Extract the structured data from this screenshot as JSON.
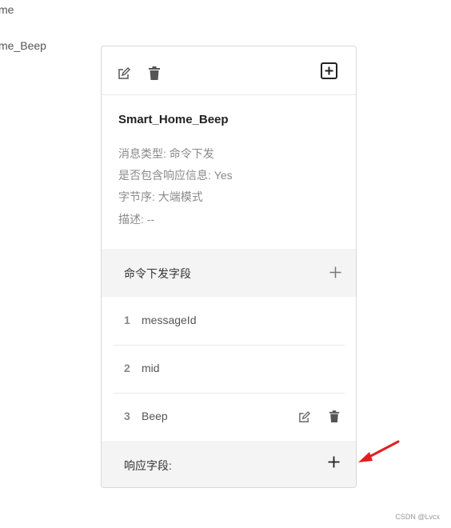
{
  "background": {
    "line1": "me",
    "line2": "me_Beep"
  },
  "card": {
    "toolbar": {
      "edit_icon": "edit-icon",
      "delete_icon": "trash-icon",
      "add_icon": "plus-square-icon"
    },
    "message_name": "Smart_Home_Beep",
    "meta": {
      "type": "消息类型: 命令下发",
      "has_response": "是否包含响应信息: Yes",
      "byte_order": "字节序: 大端模式",
      "description": "描述: --"
    },
    "command_section": {
      "title": "命令下发字段",
      "add_icon": "plus-icon",
      "fields": [
        {
          "index": "1",
          "name": "messageId"
        },
        {
          "index": "2",
          "name": "mid"
        },
        {
          "index": "3",
          "name": "Beep"
        }
      ]
    },
    "response_section": {
      "title": "响应字段:",
      "add_icon": "plus-icon"
    }
  },
  "annotation": {
    "arrow_color": "#e02020"
  },
  "watermark": "CSDN @Lvcx"
}
